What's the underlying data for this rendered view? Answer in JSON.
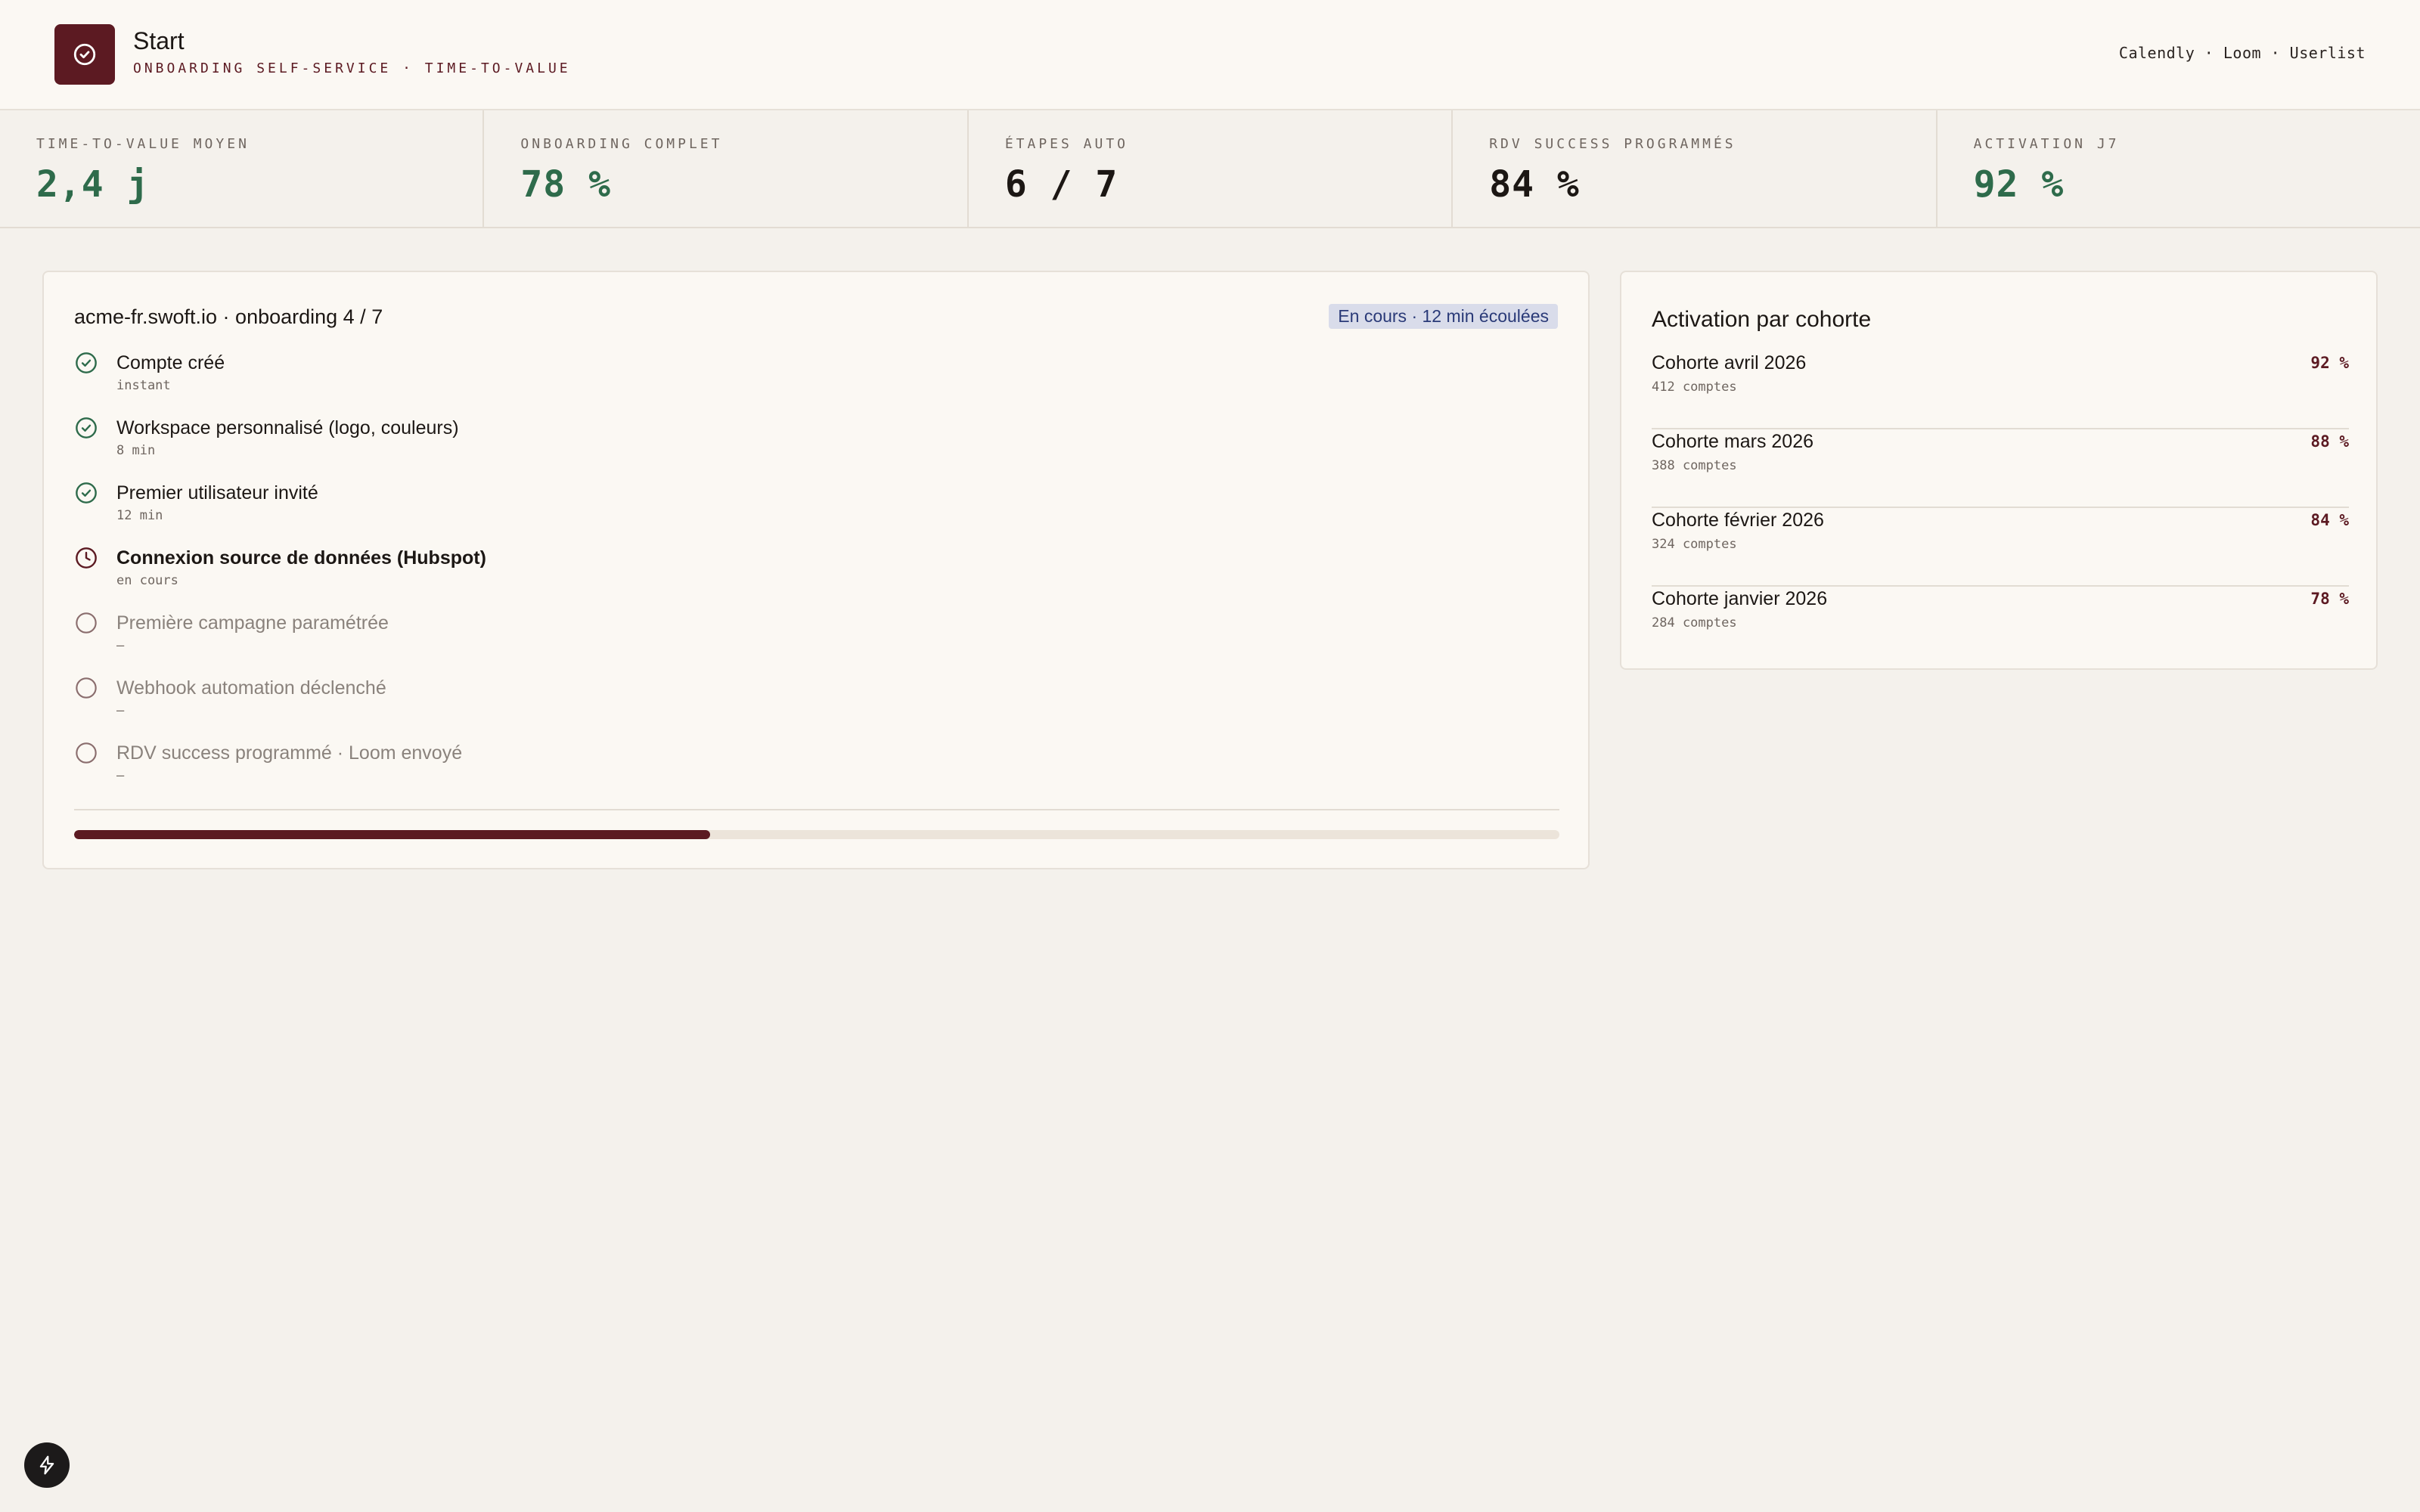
{
  "header": {
    "title": "Start",
    "subtitle": "ONBOARDING SELF-SERVICE · TIME-TO-VALUE",
    "integrations": "Calendly · Loom · Userlist"
  },
  "kpis": [
    {
      "label": "TIME-TO-VALUE MOYEN",
      "value": "2,4 j",
      "tone": "green"
    },
    {
      "label": "ONBOARDING COMPLET",
      "value": "78 %",
      "tone": "green"
    },
    {
      "label": "ÉTAPES AUTO",
      "value": "6 / 7",
      "tone": "dark"
    },
    {
      "label": "RDV SUCCESS PROGRAMMÉS",
      "value": "84 %",
      "tone": "dark"
    },
    {
      "label": "ACTIVATION J7",
      "value": "92 %",
      "tone": "green"
    }
  ],
  "onboarding": {
    "title": "acme-fr.swoft.io · onboarding 4 / 7",
    "status": "En cours · 12 min écoulées",
    "progress_fraction": 0.428,
    "steps": [
      {
        "label": "Compte créé",
        "meta": "instant",
        "state": "done"
      },
      {
        "label": "Workspace personnalisé (logo, couleurs)",
        "meta": "8 min",
        "state": "done"
      },
      {
        "label": "Premier utilisateur invité",
        "meta": "12 min",
        "state": "done"
      },
      {
        "label": "Connexion source de données (Hubspot)",
        "meta": "en cours",
        "state": "current"
      },
      {
        "label": "Première campagne paramétrée",
        "meta": "—",
        "state": "pending"
      },
      {
        "label": "Webhook automation déclenché",
        "meta": "—",
        "state": "pending"
      },
      {
        "label": "RDV success programmé · Loom envoyé",
        "meta": "—",
        "state": "pending"
      }
    ]
  },
  "cohorts": {
    "title": "Activation par cohorte",
    "rows": [
      {
        "name": "Cohorte avril 2026",
        "count": "412 comptes",
        "pct": "92 %"
      },
      {
        "name": "Cohorte mars 2026",
        "count": "388 comptes",
        "pct": "88 %"
      },
      {
        "name": "Cohorte février 2026",
        "count": "324 comptes",
        "pct": "84 %"
      },
      {
        "name": "Cohorte janvier 2026",
        "count": "284 comptes",
        "pct": "78 %"
      }
    ]
  },
  "colors": {
    "brand": "#5c1a22",
    "positive": "#2e6b4b",
    "badge_bg": "#d9dcea",
    "badge_text": "#2a3a78"
  },
  "icons": {
    "logo": "check-circle-icon",
    "step_done": "check-circle-icon",
    "step_current": "clock-icon",
    "step_pending": "empty-circle-icon",
    "fab": "lightning-icon"
  }
}
